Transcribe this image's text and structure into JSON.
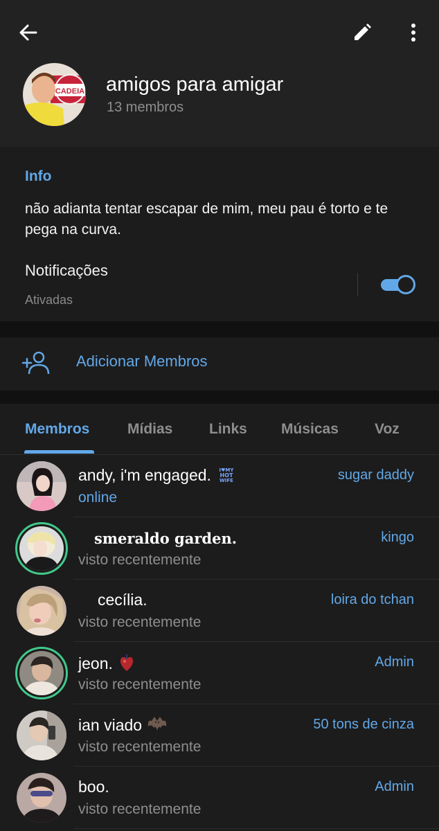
{
  "group": {
    "title": "amigos para amigar",
    "members_count": "13 membros",
    "avatar_text": "CADEIA"
  },
  "info": {
    "label": "Info",
    "description": "não adianta tentar escapar de mim, meu pau é torto e te pega na curva.",
    "notifications_label": "Notificações",
    "notifications_status": "Ativadas",
    "notifications_on": true
  },
  "add_members": {
    "label": "Adicionar Membros"
  },
  "tabs": [
    {
      "label": "Membros",
      "active": true
    },
    {
      "label": "Mídias",
      "active": false
    },
    {
      "label": "Links",
      "active": false
    },
    {
      "label": "Músicas",
      "active": false
    },
    {
      "label": "Voz",
      "active": false
    }
  ],
  "members": [
    {
      "name": "andy, i'm engaged.",
      "badge_text": "I ♥ MY HOT WIFE",
      "status": "online",
      "role": "sugar daddy"
    },
    {
      "name": "smeraldo garden.",
      "status": "visto recentemente",
      "role": "kingo"
    },
    {
      "name": "cecília.",
      "status": "visto recentemente",
      "role": "loira do tchan"
    },
    {
      "name": "jeon.",
      "status": "visto recentemente",
      "role": "Admin"
    },
    {
      "name": "ian viado",
      "status": "visto recentemente",
      "role": "50 tons de cinza"
    },
    {
      "name": "boo.",
      "status": "visto recentemente",
      "role": "Admin"
    }
  ],
  "colors": {
    "accent": "#62a8e8",
    "online_ring": "#41c98b",
    "header_bg": "#222222",
    "section_bg": "#1c1c1c"
  },
  "icons": [
    "back-arrow-icon",
    "pencil-icon",
    "more-vertical-icon",
    "add-user-icon",
    "heart-emoji-icon",
    "bat-emoji-icon"
  ]
}
